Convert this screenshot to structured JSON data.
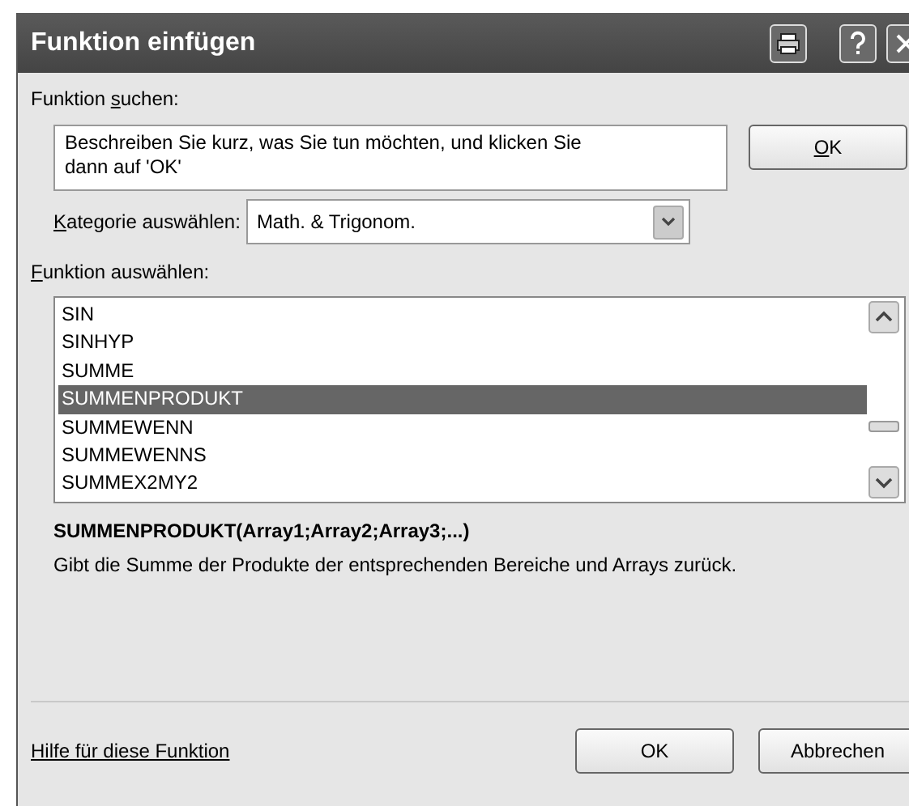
{
  "window": {
    "title": "Funktion einfügen",
    "buttons": [
      {
        "kind": "print",
        "disabled": false
      },
      {
        "kind": "help",
        "disabled": false
      },
      {
        "kind": "close",
        "disabled": false
      }
    ]
  },
  "search": {
    "label": {
      "before": "Funktion ",
      "access_key": "s",
      "after": "uchen:"
    },
    "value": "Beschreiben Sie kurz, was Sie tun möchten, und klicken Sie dann auf 'OK'",
    "button": {
      "label": {
        "access_key": "O",
        "after": "K"
      }
    }
  },
  "category": {
    "label": {
      "access_key": "K",
      "after": "ategorie auswählen:"
    },
    "value": "Math. & Trigonom."
  },
  "functions": {
    "label": {
      "access_key": "F",
      "after": "unktion auswählen:"
    },
    "items": [
      {
        "name": "SIN",
        "selected": false
      },
      {
        "name": "SINHYP",
        "selected": false
      },
      {
        "name": "SUMME",
        "selected": false
      },
      {
        "name": "SUMMENPRODUKT",
        "selected": true
      },
      {
        "name": "SUMMEWENN",
        "selected": false
      },
      {
        "name": "SUMMEWENNS",
        "selected": false
      },
      {
        "name": "SUMMEX2MY2",
        "selected": false
      }
    ]
  },
  "signature": "SUMMENPRODUKT(Array1;Array2;Array3;...)",
  "description": "Gibt die Summe der Produkte der entsprechenden Bereiche und Arrays zurück.",
  "footer": {
    "help_link": "Hilfe für diese Funktion",
    "buttons": [
      {
        "label": "OK"
      },
      {
        "label": "Abbrechen"
      }
    ]
  }
}
